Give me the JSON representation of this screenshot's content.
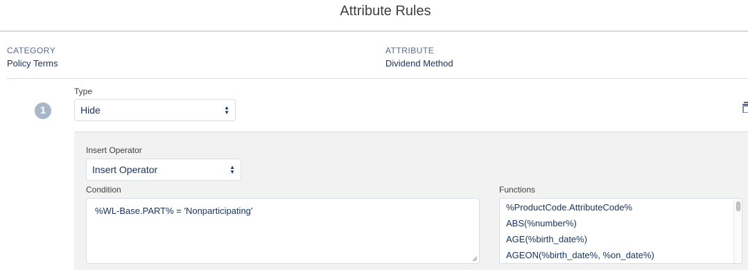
{
  "page": {
    "title": "Attribute Rules"
  },
  "meta": {
    "category_label": "CATEGORY",
    "category_value": "Policy Terms",
    "attribute_label": "ATTRIBUTE",
    "attribute_value": "Dividend Method"
  },
  "rule": {
    "step_number": "1",
    "type_label": "Type",
    "type_value": "Hide",
    "insert_operator_label": "Insert Operator",
    "insert_operator_value": "Insert Operator",
    "condition_label": "Condition",
    "condition_value": "%WL-Base.PART% = 'Nonparticipating'",
    "functions_label": "Functions",
    "functions": [
      "%ProductCode.AttributeCode%",
      "ABS(%number%)",
      "AGE(%birth_date%)",
      "AGEON(%birth_date%, %on_date%)"
    ]
  },
  "icons": {
    "select_arrows": "up-down-arrows-icon",
    "delete": "trash-icon",
    "resize": "resize-grip-icon"
  },
  "colors": {
    "title_text": "#3e3e3c",
    "badge_bg": "#a8b7c7",
    "panel_bg": "#f3f2f2",
    "border": "#d8dde6"
  }
}
